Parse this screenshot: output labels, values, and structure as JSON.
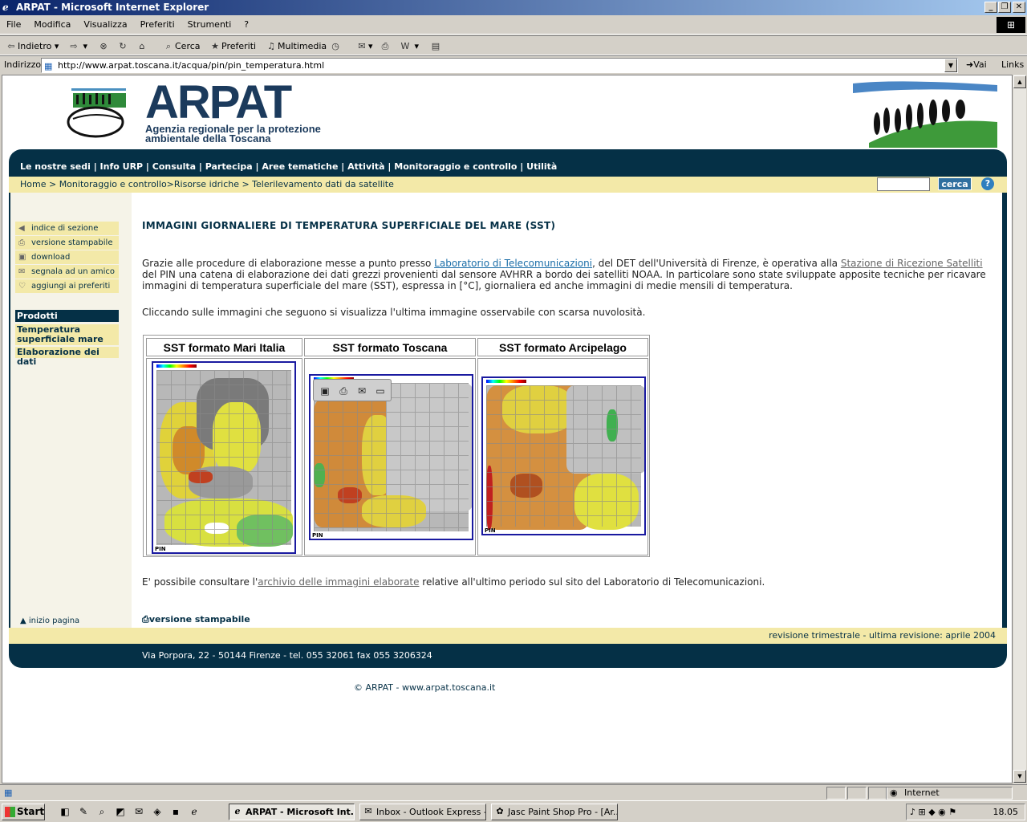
{
  "window": {
    "title": "ARPAT - Microsoft Internet Explorer"
  },
  "menubar": [
    "File",
    "Modifica",
    "Visualizza",
    "Preferiti",
    "Strumenti",
    "?"
  ],
  "toolbar": {
    "back": "Indietro",
    "search": "Cerca",
    "favorites": "Preferiti",
    "media": "Multimedia"
  },
  "address": {
    "label": "Indirizzo",
    "url": "http://www.arpat.toscana.it/acqua/pin/pin_temperatura.html",
    "go": "Vai",
    "links": "Links"
  },
  "site": {
    "logo": "ARPAT",
    "subtitle_line1": "Agenzia regionale per la protezione",
    "subtitle_line2": "ambientale della Toscana",
    "nav": "Le nostre sedi | Info URP | Consulta | Partecipa | Aree tematiche | Attività | Monitoraggio e controllo | Utilità",
    "breadcrumb": "Home > Monitoraggio e controllo>Risorse idriche > Telerilevamento dati da satellite",
    "search_button": "cerca",
    "help": "?"
  },
  "sidebar": {
    "tools": [
      "indice di sezione",
      "versione stampabile",
      "download",
      "segnala ad un amico",
      "aggiungi ai preferiti"
    ],
    "products_header": "Prodotti",
    "products": [
      "Temperatura superficiale mare",
      "Elaborazione dei dati"
    ],
    "top_link": "inizio pagina"
  },
  "content": {
    "heading": "IMMAGINI GIORNALIERE DI TEMPERATURA SUPERFICIALE DEL MARE (SST)",
    "p1_a": "Grazie alle procedure di elaborazione messe a punto presso ",
    "p1_link1": "Laboratorio di Telecomunicazioni",
    "p1_b": ", del DET dell'Università di Firenze, è operativa alla ",
    "p1_link2": "Stazione di Ricezione Satelliti",
    "p1_c": " del PIN una catena di elaborazione dei dati grezzi provenienti dal sensore AVHRR a bordo dei satelliti NOAA. In particolare sono state sviluppate apposite tecniche per ricavare immagini di temperatura superficiale del mare (SST), espressa in [°C], giornaliera ed anche immagini di medie mensili di temperatura.",
    "p2": "Cliccando sulle immagini che seguono si visualizza l'ultima immagine osservabile con scarsa nuvolosità.",
    "table_headers": [
      "SST formato Mari Italia",
      "SST formato Toscana",
      "SST formato Arcipelago"
    ],
    "p3_a": "E' possibile consultare l'",
    "p3_link": "archivio delle immagini elaborate",
    "p3_b": " relative all'ultimo periodo sul sito del Laboratorio di Telecomunicazioni.",
    "print_version": "versione stampabile",
    "revision": "revisione trimestrale - ultima revisione: aprile 2004",
    "address_footer": "Via Porpora, 22 - 50144 Firenze - tel. 055 32061 fax 055 3206324",
    "copyright": "© ARPAT - www.arpat.toscana.it"
  },
  "status": {
    "zone": "Internet"
  },
  "taskbar": {
    "start": "Start",
    "tasks": [
      "ARPAT - Microsoft Int...",
      "Inbox - Outlook Express -...",
      "Jasc Paint Shop Pro - [Ar..."
    ],
    "clock": "18.05"
  }
}
